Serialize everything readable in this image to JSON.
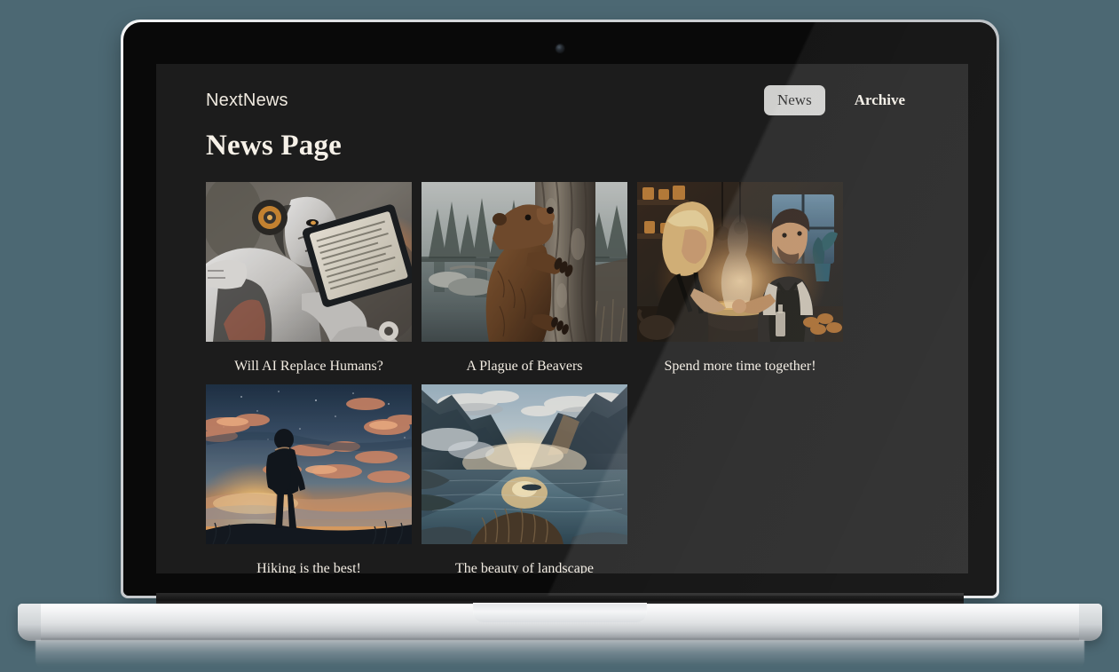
{
  "background_color": "#4c6873",
  "device": {
    "name": "laptop-mockup",
    "screen_background": "#1c1c1c",
    "bezel_color": "#090909",
    "body_color": "#dfe1e3"
  },
  "site": {
    "brand": "NextNews",
    "nav": [
      {
        "label": "News",
        "active": true
      },
      {
        "label": "Archive",
        "active": false
      }
    ],
    "active_accent": "#cfcfcd",
    "text_color": "#f1ece3"
  },
  "page": {
    "title": "News Page"
  },
  "articles": [
    {
      "title": "Will AI Replace Humans?",
      "image_alt": "humanoid-robot-reading-tablet"
    },
    {
      "title": "A Plague of Beavers",
      "image_alt": "beaver-climbing-tree-by-lake"
    },
    {
      "title": "Spend more time together!",
      "image_alt": "couple-cooking-in-kitchen"
    },
    {
      "title": "Hiking is the best!",
      "image_alt": "hiker-silhouette-at-sunset"
    },
    {
      "title": "The beauty of landscape",
      "image_alt": "misty-mountain-lake-at-sunrise"
    }
  ]
}
